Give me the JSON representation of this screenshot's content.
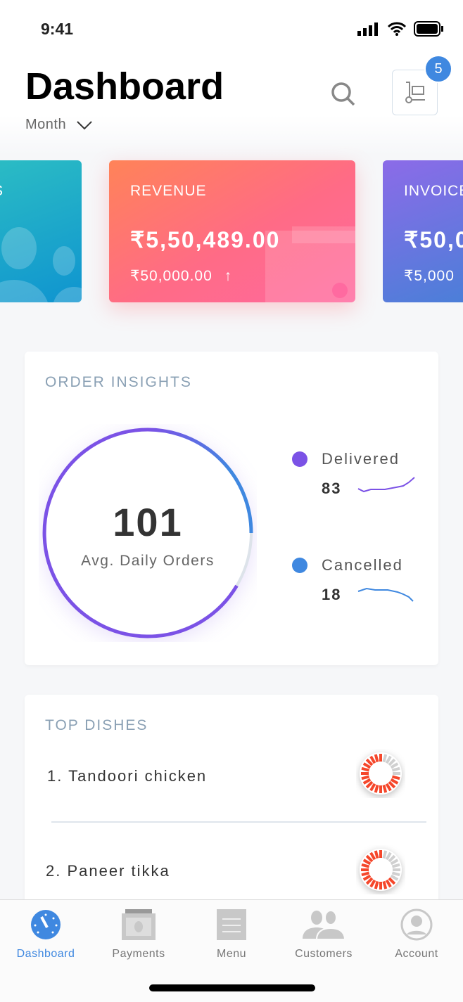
{
  "status": {
    "time": "9:41"
  },
  "header": {
    "title": "Dashboard",
    "period": "Month",
    "cart_badge": "5"
  },
  "cards": [
    {
      "label": "CUSTOMERS",
      "partial_label": "S"
    },
    {
      "label": "REVENUE",
      "amount": "₹5,50,489.00",
      "change": "₹50,000.00",
      "trend": "up"
    },
    {
      "label": "INVOICE",
      "amount": "₹50,0",
      "change": "₹5,000"
    }
  ],
  "order_insights": {
    "title": "ORDER INSIGHTS",
    "value": "101",
    "caption": "Avg. Daily Orders",
    "legend": [
      {
        "name": "Delivered",
        "count": "83",
        "color": "#7b52e6"
      },
      {
        "name": "Cancelled",
        "count": "18",
        "color": "#3f88e0"
      }
    ]
  },
  "top_dishes": {
    "title": "TOP DISHES",
    "items": [
      {
        "name": "1. Tandoori chicken",
        "level": 0.75
      },
      {
        "name": "2. Paneer tikka",
        "level": 0.7
      }
    ]
  },
  "tabbar": {
    "items": [
      {
        "label": "Dashboard",
        "active": true
      },
      {
        "label": "Payments"
      },
      {
        "label": "Menu"
      },
      {
        "label": "Customers"
      },
      {
        "label": "Account"
      }
    ]
  },
  "colors": {
    "accent": "#3f88e0",
    "purple": "#7b52e6",
    "red": "#f5472b"
  }
}
